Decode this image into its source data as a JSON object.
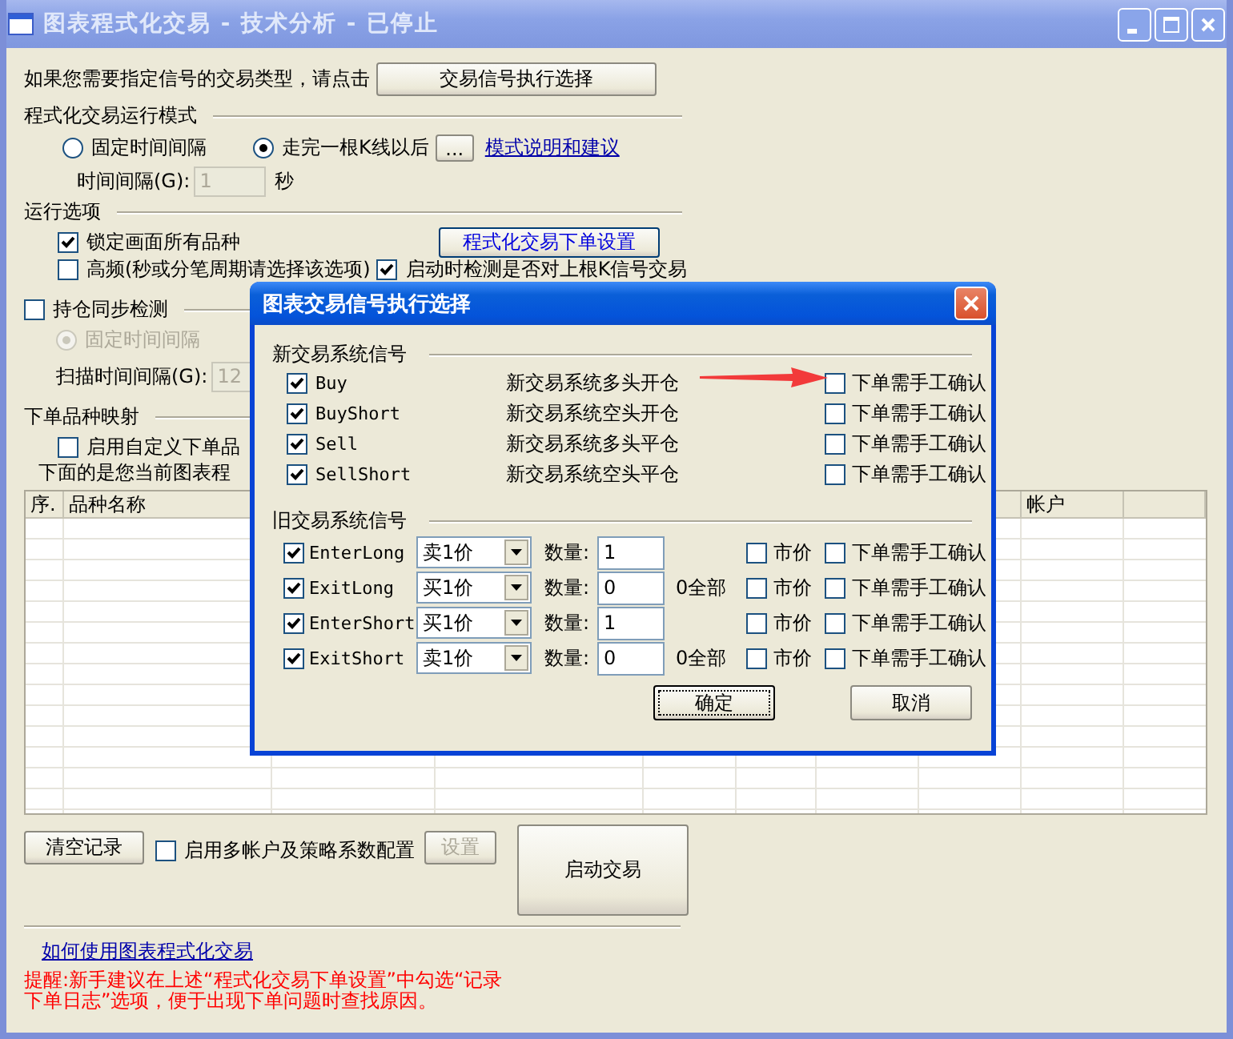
{
  "window": {
    "title": "图表程式化交易 - 技术分析 - 已停止"
  },
  "signal_prompt": {
    "text": "如果您需要指定信号的交易类型，请点击",
    "button": "交易信号执行选择"
  },
  "run_mode": {
    "heading": "程式化交易运行模式",
    "options": [
      {
        "label": "固定时间间隔",
        "selected": false
      },
      {
        "label": "走完一根K线以后",
        "selected": true
      }
    ],
    "more_button": "...",
    "help_link": "模式说明和建议",
    "interval_label": "时间间隔(G):",
    "interval_value": "1",
    "interval_disabled": true,
    "interval_unit": "秒"
  },
  "run_options": {
    "heading": "运行选项",
    "order_settings_button": "程式化交易下单设置",
    "checkboxes": [
      {
        "label": "锁定画面所有品种",
        "checked": true
      },
      {
        "label": "高频(秒或分笔周期请选择该选项)",
        "checked": false
      },
      {
        "label": "启动时检测是否对上根K信号交易",
        "checked": true
      }
    ]
  },
  "position_sync": {
    "label": "持仓同步检测",
    "checked": false,
    "option": {
      "label": "固定时间间隔",
      "selected": true,
      "disabled": true
    },
    "scan_label": "扫描时间间隔(G):",
    "scan_value": "12"
  },
  "symbol_mapping": {
    "heading": "下单品种映射",
    "checkbox": {
      "label": "启用自定义下单品",
      "checked": false
    },
    "note": "下面的是您当前图表程"
  },
  "table": {
    "columns": [
      {
        "label": "序."
      },
      {
        "label": "品种名称"
      },
      {
        "label": "帐户"
      }
    ]
  },
  "bottom": {
    "clear_button": "清空记录",
    "multi_account": {
      "label": "启用多帐户及策略系数配置",
      "checked": false
    },
    "settings_button": {
      "label": "设置",
      "disabled": true
    },
    "start_button": "启动交易"
  },
  "help_link": "如何使用图表程式化交易",
  "reminder": "提醒:新手建议在上述“程式化交易下单设置”中勾选“记录下单日志”选项，便于出现下单问题时查找原因。",
  "dialog": {
    "title": "图表交易信号执行选择",
    "new_signals": {
      "heading": "新交易系统信号",
      "rows": [
        {
          "signal": "Buy",
          "enabled": true,
          "description": "新交易系统多头开仓",
          "confirm_label": "下单需手工确认",
          "manual_confirm": false
        },
        {
          "signal": "BuyShort",
          "enabled": true,
          "description": "新交易系统空头开仓",
          "confirm_label": "下单需手工确认",
          "manual_confirm": false
        },
        {
          "signal": "Sell",
          "enabled": true,
          "description": "新交易系统多头平仓",
          "confirm_label": "下单需手工确认",
          "manual_confirm": false
        },
        {
          "signal": "SellShort",
          "enabled": true,
          "description": "新交易系统空头平仓",
          "confirm_label": "下单需手工确认",
          "manual_confirm": false
        }
      ]
    },
    "old_signals": {
      "heading": "旧交易系统信号",
      "rows": [
        {
          "signal": "EnterLong",
          "enabled": true,
          "price": "卖1价",
          "quantity_label": "数量:",
          "quantity": "1",
          "market_label": "市价",
          "market": false,
          "confirm_label": "下单需手工确认",
          "manual_confirm": false
        },
        {
          "signal": "ExitLong",
          "enabled": true,
          "price": "买1价",
          "quantity_label": "数量:",
          "quantity": "0",
          "quantity_note": "0全部",
          "market_label": "市价",
          "market": false,
          "confirm_label": "下单需手工确认",
          "manual_confirm": false
        },
        {
          "signal": "EnterShort",
          "enabled": true,
          "price": "买1价",
          "quantity_label": "数量:",
          "quantity": "1",
          "market_label": "市价",
          "market": false,
          "confirm_label": "下单需手工确认",
          "manual_confirm": false
        },
        {
          "signal": "ExitShort",
          "enabled": true,
          "price": "卖1价",
          "quantity_label": "数量:",
          "quantity": "0",
          "quantity_note": "0全部",
          "market_label": "市价",
          "market": false,
          "confirm_label": "下单需手工确认",
          "manual_confirm": false
        }
      ]
    },
    "buttons": [
      {
        "label": "确定",
        "focused": true
      },
      {
        "label": "取消",
        "focused": false
      }
    ]
  }
}
